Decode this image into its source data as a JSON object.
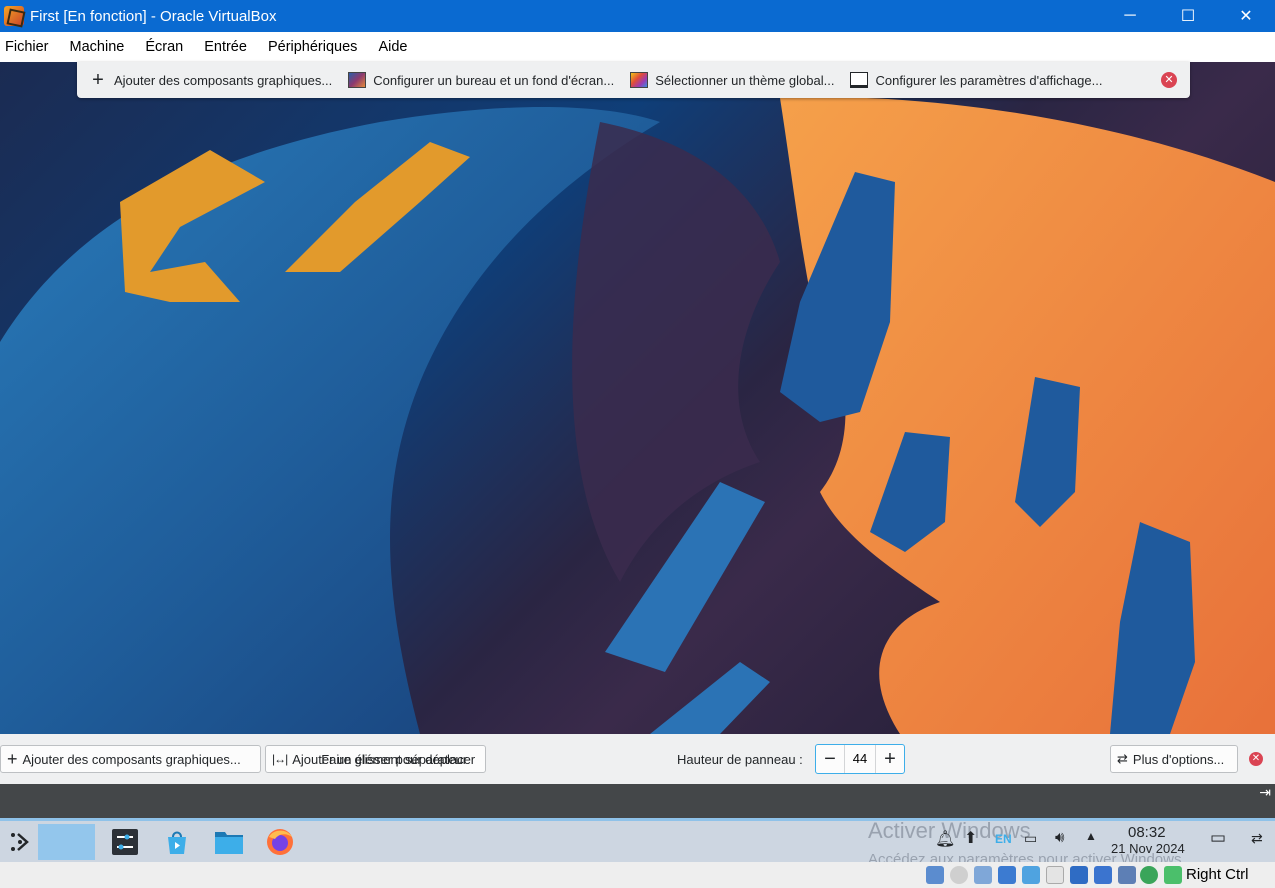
{
  "window": {
    "title": "First [En fonction] - Oracle VirtualBox",
    "minimize": "─",
    "maximize": "☐",
    "close": "✕"
  },
  "menu": [
    "Fichier",
    "Machine",
    "Écran",
    "Entrée",
    "Périphériques",
    "Aide"
  ],
  "top_toolbar": {
    "add_widgets": "Ajouter des composants graphiques...",
    "configure_desktop": "Configurer un bureau et un fond d'écran...",
    "select_theme": "Sélectionner un thème global...",
    "display_settings": "Configurer les paramètres d'affichage..."
  },
  "panel_edit": {
    "add_widgets": "Ajouter des composants graphiques...",
    "add_spacer": "Ajouter un élément séparateur",
    "drag_hint": "Faire glisser pour déplacer",
    "height_label": "Hauteur de panneau :",
    "height_value": "44",
    "more_options": "Plus d'options..."
  },
  "taskbar": {
    "watermark_title": "Activer Windows",
    "watermark_sub": "Accédez aux paramètres pour activer Windows.",
    "lang": "EN",
    "time": "08:32",
    "date": "21 Nov 2024"
  },
  "vbox_status": {
    "host_key": "Right Ctrl"
  }
}
